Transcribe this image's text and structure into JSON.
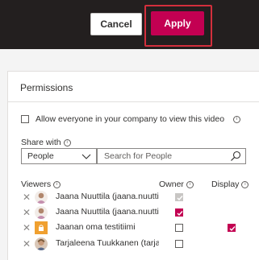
{
  "toolbar": {
    "cancel_label": "Cancel",
    "apply_label": "Apply"
  },
  "permissions": {
    "title": "Permissions",
    "allow_everyone_label": "Allow everyone in your company to view this video",
    "share_with_label": "Share with",
    "share_with_selected": "People",
    "search_placeholder": "Search for People",
    "columns": {
      "viewers": "Viewers",
      "owner": "Owner",
      "display": "Display"
    },
    "viewers": [
      {
        "name": "Jaana Nuuttila (jaana.nuutti...",
        "owner": true,
        "owner_locked": true,
        "display": false,
        "display_visible": false
      },
      {
        "name": "Jaana Nuuttila (jaana.nuutti...",
        "owner": true,
        "owner_locked": false,
        "display": false,
        "display_visible": false
      },
      {
        "name": "Jaanan oma testitiimi",
        "owner": false,
        "owner_locked": false,
        "display": true,
        "display_visible": true
      },
      {
        "name": "Tarjaleena Tuukkanen (tarja...",
        "owner": false,
        "owner_locked": false,
        "display": false,
        "display_visible": false
      }
    ]
  },
  "colors": {
    "accent": "#c30052",
    "topbar": "#231f1f",
    "highlight": "#d32f3c"
  }
}
